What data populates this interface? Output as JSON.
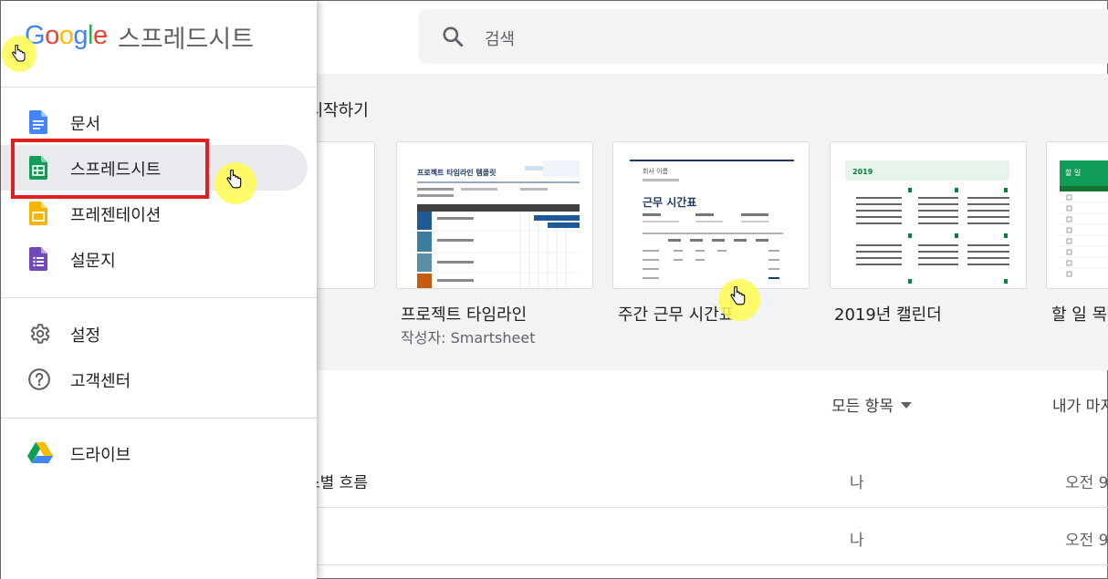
{
  "app": {
    "logo_letters": [
      "G",
      "o",
      "o",
      "g",
      "l",
      "e"
    ],
    "logo_colors": [
      "#4285F4",
      "#EA4335",
      "#FBBC05",
      "#4285F4",
      "#34A853",
      "#EA4335"
    ],
    "product_name": "스프레드시트"
  },
  "search": {
    "placeholder": "검색",
    "icon": "search-icon"
  },
  "drawer": {
    "apps": [
      {
        "label": "문서",
        "icon": "docs-icon",
        "color": "#4285F4"
      },
      {
        "label": "스프레드시트",
        "icon": "sheets-icon",
        "color": "#0F9D58",
        "active": true
      },
      {
        "label": "프레젠테이션",
        "icon": "slides-icon",
        "color": "#F4B400"
      },
      {
        "label": "설문지",
        "icon": "forms-icon",
        "color": "#7248B9"
      }
    ],
    "settings": [
      {
        "label": "설정",
        "icon": "gear-icon"
      },
      {
        "label": "고객센터",
        "icon": "help-icon"
      }
    ],
    "drive": {
      "label": "드라이브",
      "icon": "drive-icon"
    }
  },
  "templates": {
    "section_title": "시작하기",
    "items": [
      {
        "name": "",
        "author": ""
      },
      {
        "name": "프로젝트 타임라인",
        "author": "작성자: Smartsheet",
        "preview_title": "프로젝트 타임라인 템플릿"
      },
      {
        "name": "주간 근무 시간표",
        "author": "",
        "preview_company": "회사 이름",
        "preview_title": "근무 시간표"
      },
      {
        "name": "2019년 캘린더",
        "author": "",
        "preview_year": "2019"
      },
      {
        "name": "할 일 목",
        "author": "",
        "preview_title": "할 일"
      }
    ]
  },
  "file_list": {
    "filter_label": "모든 항목",
    "owner_header": "내가 마지",
    "rows": [
      {
        "name": "스별 흐름",
        "owner": "나",
        "time": "오전 9"
      },
      {
        "name": "|",
        "owner": "나",
        "time": "오전 9"
      }
    ]
  },
  "colors": {
    "highlight": "#E02020",
    "cursor": "#FFF950",
    "band": "#F1F3F4",
    "sheets_green": "#0F9D58"
  }
}
